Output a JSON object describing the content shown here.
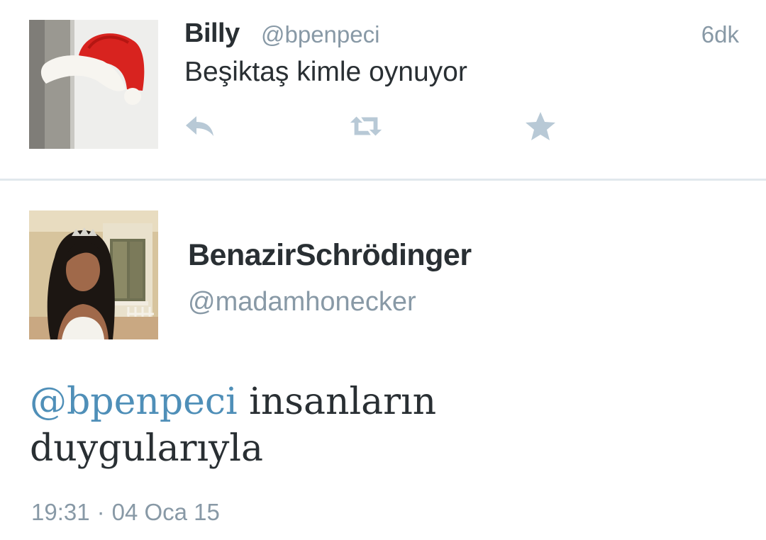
{
  "tweet1": {
    "name": "Billy",
    "handle": "@bpenpeci",
    "time": "6dk",
    "text": "Beşiktaş kimle oynuyor",
    "actions": {
      "reply_icon": "reply-icon",
      "retweet_icon": "retweet-icon",
      "favorite_icon": "star-icon"
    }
  },
  "tweet2": {
    "name": "BenazirSchrödinger",
    "handle": "@madamhonecker",
    "mention": "@bpenpeci",
    "text_rest": " insanların",
    "text_line2": "duygularıyla",
    "time": "19:31",
    "separator": "·",
    "date": "04 Oca 15"
  },
  "colors": {
    "name": "#292f33",
    "muted": "#8899a6",
    "mention": "#4f8fb8",
    "icon": "#b8c9d6",
    "divider": "#e1e8ed"
  }
}
